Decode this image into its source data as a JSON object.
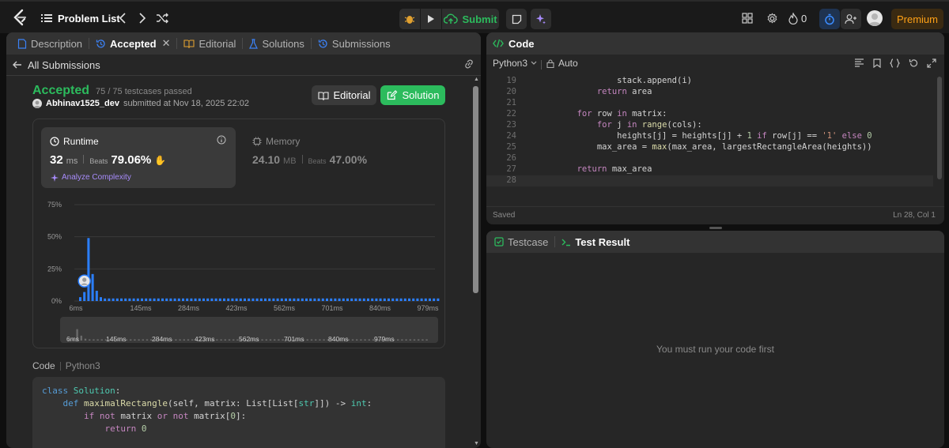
{
  "topbar": {
    "problem_list": "Problem List",
    "submit": "Submit",
    "streak": "0",
    "premium": "Premium"
  },
  "left": {
    "tabs": [
      "Description",
      "Accepted",
      "Editorial",
      "Solutions",
      "Submissions"
    ],
    "back": "All Submissions",
    "status": "Accepted",
    "testcases": "75 / 75 testcases passed",
    "user": "Abhinav1525_dev",
    "submitted": "submitted at Nov 18, 2025 22:02",
    "editorial_btn": "Editorial",
    "solution_btn": "Solution",
    "runtime": {
      "label": "Runtime",
      "value": "32",
      "unit": "ms",
      "beats_label": "Beats",
      "beats": "79.06%",
      "analyze": "Analyze Complexity"
    },
    "memory": {
      "label": "Memory",
      "value": "24.10",
      "unit": "MB",
      "beats_label": "Beats",
      "beats": "47.00%"
    },
    "code_label": "Code",
    "lang": "Python3"
  },
  "chart_data": {
    "type": "bar",
    "ylabels": [
      "75%",
      "50%",
      "25%",
      "0%"
    ],
    "xlabels": [
      "6ms",
      "145ms",
      "284ms",
      "423ms",
      "562ms",
      "701ms",
      "840ms",
      "979ms"
    ],
    "values": [
      3,
      7,
      49,
      21,
      8,
      3,
      2,
      2,
      2,
      2,
      2,
      2,
      2,
      2,
      2,
      2,
      2,
      2,
      2,
      2,
      2,
      2,
      2,
      2,
      2,
      2,
      2,
      2,
      2,
      2,
      2,
      2,
      2,
      2,
      2,
      2,
      2,
      2,
      2,
      2,
      2,
      2,
      2,
      2,
      2,
      2,
      2,
      2,
      2,
      2,
      2,
      2,
      2,
      2,
      2,
      2,
      2,
      2,
      2,
      2,
      2,
      2,
      2,
      2,
      2,
      2,
      2,
      2,
      2,
      2,
      2,
      2,
      2,
      2,
      2,
      2,
      2,
      2,
      2,
      2,
      2,
      2,
      2,
      2,
      2,
      2,
      2,
      2
    ],
    "ylim": [
      0,
      75
    ],
    "user_bar_index": 1,
    "accent": "#2b7fff"
  },
  "code_preview": [
    [
      [
        "kw",
        "class "
      ],
      [
        "cls",
        "Solution"
      ],
      [
        "pl",
        ":"
      ]
    ],
    [
      [
        "pl",
        "    "
      ],
      [
        "kw",
        "def "
      ],
      [
        "fn",
        "maximalRectangle"
      ],
      [
        "pl",
        "(self, matrix: List[List["
      ],
      [
        "cls",
        "str"
      ],
      [
        "pl",
        "]]) -> "
      ],
      [
        "cls",
        "int"
      ],
      [
        "pl",
        ":"
      ]
    ],
    [
      [
        "pl",
        "        "
      ],
      [
        "kw2",
        "if not "
      ],
      [
        "pl",
        "matrix "
      ],
      [
        "kw2",
        "or not "
      ],
      [
        "pl",
        "matrix["
      ],
      [
        "num",
        "0"
      ],
      [
        "pl",
        "]:"
      ]
    ],
    [
      [
        "pl",
        "            "
      ],
      [
        "kw2",
        "return "
      ],
      [
        "num",
        "0"
      ]
    ]
  ],
  "right": {
    "code_title": "Code",
    "lang": "Python3",
    "auto": "Auto",
    "saved": "Saved",
    "position": "Ln 28, Col 1",
    "testcase_tab": "Testcase",
    "result_tab": "Test Result",
    "empty_msg": "You must run your code first"
  },
  "editor_lines": [
    {
      "n": "19",
      "t": [
        [
          "pl",
          "                stack.append(i)"
        ]
      ]
    },
    {
      "n": "20",
      "t": [
        [
          "pl",
          "            "
        ],
        [
          "kw2",
          "return "
        ],
        [
          "pl",
          "area"
        ]
      ]
    },
    {
      "n": "21",
      "t": []
    },
    {
      "n": "22",
      "t": [
        [
          "pl",
          "        "
        ],
        [
          "kw2",
          "for "
        ],
        [
          "pl",
          "row "
        ],
        [
          "kw2",
          "in "
        ],
        [
          "pl",
          "matrix:"
        ]
      ]
    },
    {
      "n": "23",
      "t": [
        [
          "pl",
          "            "
        ],
        [
          "kw2",
          "for "
        ],
        [
          "pl",
          "j "
        ],
        [
          "kw2",
          "in "
        ],
        [
          "fn",
          "range"
        ],
        [
          "pl",
          "(cols):"
        ]
      ]
    },
    {
      "n": "24",
      "t": [
        [
          "pl",
          "                heights[j] = heights[j] + "
        ],
        [
          "num",
          "1 "
        ],
        [
          "kw2",
          "if "
        ],
        [
          "pl",
          "row[j] == "
        ],
        [
          "str",
          "'1' "
        ],
        [
          "kw2",
          "else "
        ],
        [
          "num",
          "0"
        ]
      ]
    },
    {
      "n": "25",
      "t": [
        [
          "pl",
          "            max_area = "
        ],
        [
          "fn",
          "max"
        ],
        [
          "pl",
          "(max_area, largestRectangleArea(heights))"
        ]
      ]
    },
    {
      "n": "26",
      "t": []
    },
    {
      "n": "27",
      "t": [
        [
          "pl",
          "        "
        ],
        [
          "kw2",
          "return "
        ],
        [
          "pl",
          "max_area"
        ]
      ]
    },
    {
      "n": "28",
      "t": []
    }
  ]
}
